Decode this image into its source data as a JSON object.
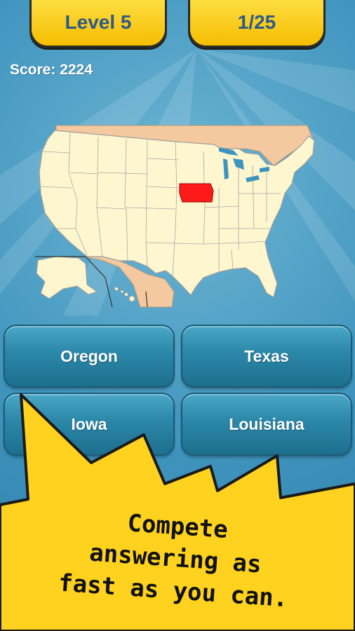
{
  "header": {
    "level_label": "Level 5",
    "progress_label": "1/25"
  },
  "score": {
    "text": "Score: 2224"
  },
  "map": {
    "highlighted_state": "Iowa",
    "highlight_color": "#ff1a1a",
    "land_color": "#fdf6cf",
    "neighbor_color": "#f5c9a0",
    "water_color": "#3f94be"
  },
  "answers": [
    {
      "label": "Oregon"
    },
    {
      "label": "Texas"
    },
    {
      "label": "Iowa"
    },
    {
      "label": "Louisiana"
    }
  ],
  "promo": {
    "line1": "Compete",
    "line2": "answering as",
    "line3": "fast as you can."
  },
  "colors": {
    "header_yellow": "#ffd60a",
    "header_text": "#2e5a86",
    "button_teal": "#2b87a8",
    "burst_yellow": "#ffd21f"
  }
}
